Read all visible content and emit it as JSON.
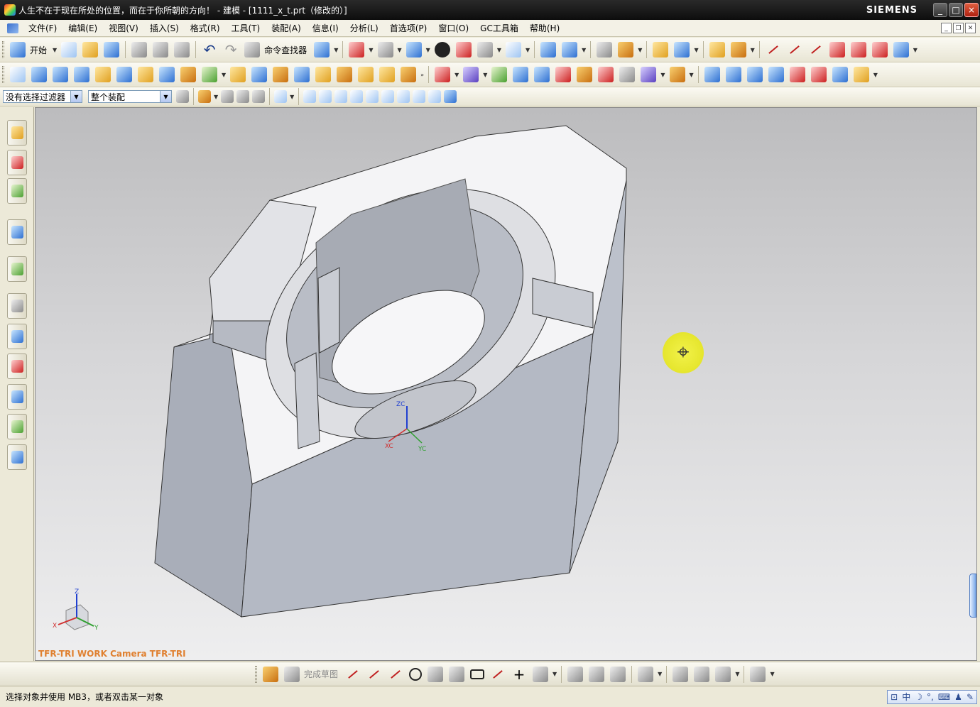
{
  "window": {
    "title": "人生不在于现在所处的位置，而在于你所朝的方向！ - 建模 - [1111_x_t.prt（修改的）]",
    "brand": "SIEMENS",
    "minimize": "_",
    "maximize": "□",
    "close": "×"
  },
  "menu": [
    "文件(F)",
    "编辑(E)",
    "视图(V)",
    "插入(S)",
    "格式(R)",
    "工具(T)",
    "装配(A)",
    "信息(I)",
    "分析(L)",
    "首选项(P)",
    "窗口(O)",
    "GC工具箱",
    "帮助(H)"
  ],
  "toolbar1": {
    "start_label": "开始",
    "command_finder_label": "命令查找器"
  },
  "selection_bar": {
    "filter_value": "没有选择过滤器",
    "scope_value": "整个装配"
  },
  "viewport": {
    "view_label": "TFR-TRI WORK Camera TFR-TRI",
    "csys": {
      "z": "ZC",
      "x": "XC",
      "y": "YC"
    },
    "triad": {
      "z": "Z",
      "x": "X",
      "y": "Y"
    }
  },
  "sketchbar": {
    "finish_label": "完成草图"
  },
  "status": {
    "prompt": "选择对象并使用 MB3，或者双击某一对象",
    "ime_label": "中"
  },
  "icons": {
    "resource_bar": [
      "assembly-navigator-icon",
      "part-navigator-icon",
      "reuse-library-icon",
      "web-browser-icon",
      "history-icon",
      "system-materials-icon",
      "process-studio-icon",
      "manufacturing-wizard-icon",
      "roles-icon",
      "system-scenes-icon",
      "hd3d-tools-icon"
    ]
  }
}
